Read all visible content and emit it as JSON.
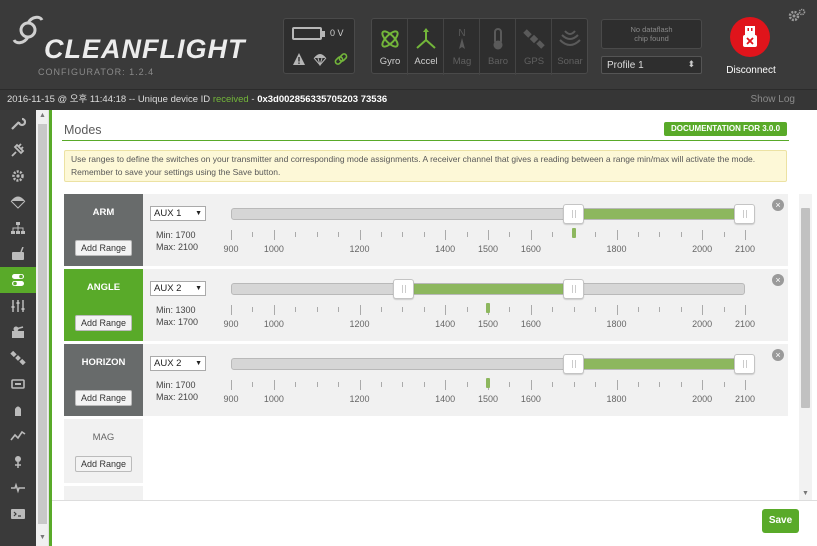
{
  "app": {
    "logo_text": "CLEANFLIGHT",
    "subtitle": "CONFIGURATOR: 1.2.4"
  },
  "header": {
    "battery_voltage": "0 V",
    "sensors": [
      {
        "name": "Gyro",
        "active": true
      },
      {
        "name": "Accel",
        "active": true
      },
      {
        "name": "Mag",
        "active": false
      },
      {
        "name": "Baro",
        "active": false
      },
      {
        "name": "GPS",
        "active": false
      },
      {
        "name": "Sonar",
        "active": false
      }
    ],
    "mag_glyph": "N",
    "dataflash_line1": "No dataflash",
    "dataflash_line2": "chip found",
    "profile": "Profile 1",
    "disconnect_label": "Disconnect"
  },
  "status_bar": {
    "timestamp": "2016-11-15 @ 오후 11:44:18",
    "separator": " -- Unique device ID ",
    "received": "received",
    "id_separator": " - ",
    "device_id": "0x3d002856335705203 73536",
    "show_log": "Show Log"
  },
  "page": {
    "title": "Modes",
    "doc_button": "DOCUMENTATION FOR 3.0.0",
    "notice": "Use ranges to define the switches on your transmitter and corresponding mode assignments. A receiver channel that gives a reading between a range min/max will activate the mode. Remember to save your settings using the Save button."
  },
  "scale_labels": [
    "900",
    "1000",
    "1200",
    "1400",
    "1500",
    "1600",
    "1800",
    "2000",
    "2100"
  ],
  "modes": [
    {
      "name": "ARM",
      "state": "configured",
      "add_label": "Add Range",
      "aux": "AUX 1",
      "min_label": "Min: 1700",
      "max_label": "Max: 2100",
      "min": 1700,
      "max": 2100,
      "channel_value": 1700,
      "remove": "×"
    },
    {
      "name": "ANGLE",
      "state": "active",
      "add_label": "Add Range",
      "aux": "AUX 2",
      "min_label": "Min: 1300",
      "max_label": "Max: 1700",
      "min": 1300,
      "max": 1700,
      "channel_value": 1500,
      "remove": "×"
    },
    {
      "name": "HORIZON",
      "state": "configured",
      "add_label": "Add Range",
      "aux": "AUX 2",
      "min_label": "Min: 1700",
      "max_label": "Max: 2100",
      "min": 1700,
      "max": 2100,
      "channel_value": 1500,
      "remove": "×"
    },
    {
      "name": "MAG",
      "state": "inactive",
      "add_label": "Add Range"
    }
  ],
  "footer": {
    "save_label": "Save"
  },
  "colors": {
    "accent": "#59aa29",
    "range_fill": "#8db75e",
    "disconnect": "#e0141b"
  }
}
